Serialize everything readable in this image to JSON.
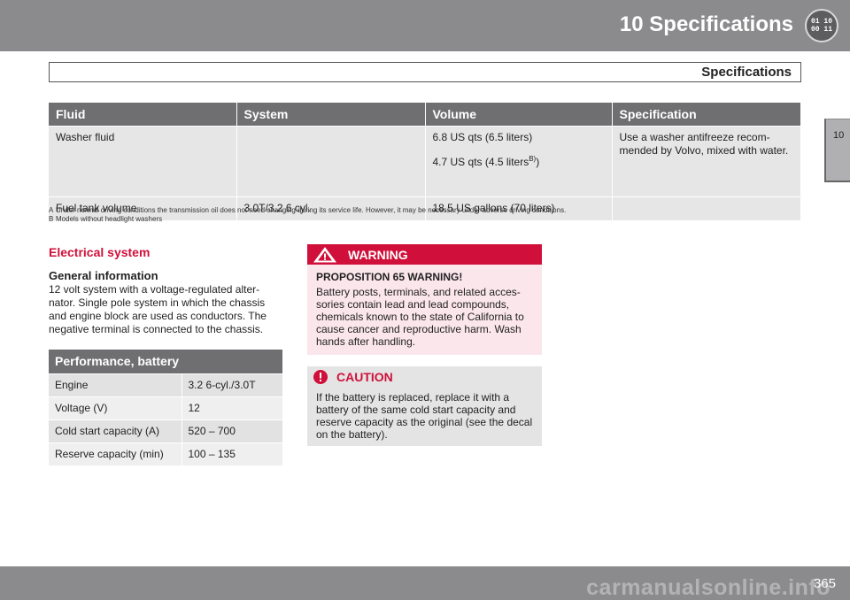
{
  "header": {
    "chapter_title": "10 Specifications",
    "chapter_icon_digits": "01 10 00 11",
    "section_title": "Specifications",
    "side_tab": "10"
  },
  "fluids_table": {
    "headers": [
      "Fluid",
      "System",
      "Volume",
      "Specification"
    ],
    "rows": [
      {
        "fluid": "Washer fluid",
        "system": "",
        "volume_1": "6.8 US qts (6.5 liters)",
        "volume_2": "4.7 US qts (4.5 liters",
        "volume_2_sup": "B)",
        "volume_2_end": ")",
        "specification": "Use a washer antifreeze recom-mended by Volvo, mixed with water."
      },
      {
        "fluid": "Fuel tank volume",
        "system": "3.0T/3.2 6 cyl.",
        "volume_1": "18.5 US gallons (70 liters)",
        "specification": ""
      }
    ],
    "footnotes": [
      {
        "mark": "A",
        "text": "Under normal driving conditions the transmission oil does not need changing during its service life. However, it may be necessary under adverse driving conditions."
      },
      {
        "mark": "B",
        "text": "Models without headlight washers"
      }
    ]
  },
  "electrical": {
    "heading": "Electrical system",
    "general_heading": "General information",
    "general_body": "12 volt system with a voltage-regulated alter-nator. Single pole system in which the chassis and engine block are used as conductors. The negative terminal is connected to the chassis.",
    "battery_table": {
      "title": "Performance, battery",
      "rows": [
        {
          "label": "Engine",
          "value": "3.2 6-cyl./3.0T"
        },
        {
          "label": "Voltage (V)",
          "value": "12"
        },
        {
          "label": "Cold start capacity (A)",
          "value": "520 – 700"
        },
        {
          "label": "Reserve capacity (min)",
          "value": "100 – 135"
        }
      ]
    }
  },
  "warning": {
    "label": "WARNING",
    "title": "PROPOSITION 65 WARNING!",
    "body": "Battery posts, terminals, and related acces-sories contain lead and lead compounds, chemicals known to the state of California to cause cancer and reproductive harm. Wash hands after handling.",
    "icon": "warning-triangle-icon"
  },
  "caution": {
    "label": "CAUTION",
    "body": "If the battery is replaced, replace it with a battery of the same cold start capacity and reserve capacity as the original (see the decal on the battery).",
    "icon": "caution-circle-icon"
  },
  "footer": {
    "page_number": "365",
    "watermark": "carmanualsonline.info"
  },
  "colors": {
    "header_gray": "#8b8b8d",
    "table_header": "#6f6f72",
    "accent_red": "#d0103a",
    "warning_bg": "#fbe6ec"
  }
}
